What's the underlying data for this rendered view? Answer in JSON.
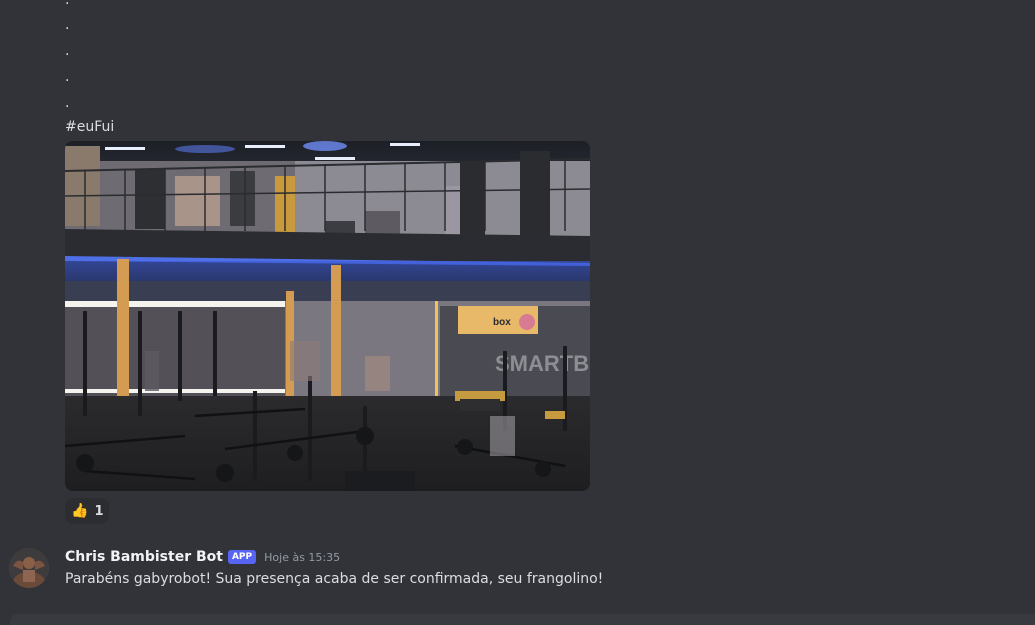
{
  "previous_message": {
    "dots": [
      ".",
      ".",
      ".",
      ".",
      "."
    ],
    "hashtag": "#euFui",
    "attachment": {
      "description": "gym-photo"
    },
    "reaction": {
      "emoji": "👍",
      "count": "1"
    }
  },
  "bot_message": {
    "username": "Chris Bambister Bot",
    "badge": "APP",
    "timestamp": "Hoje às 15:35",
    "text": "Parabéns gabyrobot! Sua presença acaba de ser confirmada, seu frangolino!"
  }
}
